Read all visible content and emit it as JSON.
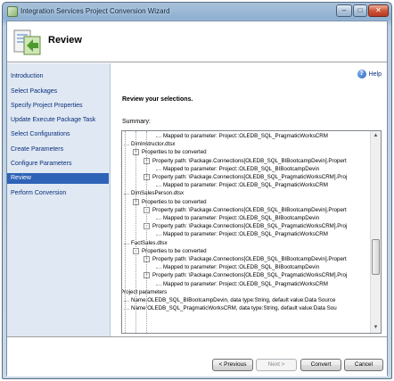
{
  "window": {
    "title": "Integration Services Project Conversion Wizard"
  },
  "header": {
    "title": "Review"
  },
  "nav": {
    "items": [
      {
        "label": "Introduction",
        "active": false
      },
      {
        "label": "Select Packages",
        "active": false
      },
      {
        "label": "Specify Project Properties",
        "active": false
      },
      {
        "label": "Update Execute Package Task",
        "active": false
      },
      {
        "label": "Select Configurations",
        "active": false
      },
      {
        "label": "Create Parameters",
        "active": false
      },
      {
        "label": "Configure Parameters",
        "active": false
      },
      {
        "label": "Review",
        "active": true
      },
      {
        "label": "Perform Conversion",
        "active": false
      }
    ]
  },
  "content": {
    "help_label": "Help",
    "heading": "Review your selections.",
    "summary_label": "Summary:",
    "tree": [
      {
        "text": "Mapped to parameter:  Project::OLEDB_SQL_PragmaticWorksCRM",
        "level": 5,
        "toggle": ""
      },
      {
        "text": "DimInstructor.dtsx",
        "level": 2,
        "toggle": ""
      },
      {
        "text": "Properties to be converted",
        "level": 3,
        "toggle": "-"
      },
      {
        "text": "Property path:  \\Package.Connections[OLEDB_SQL_BIBootcampDevin].Propert",
        "level": 4,
        "toggle": "-"
      },
      {
        "text": "Mapped to parameter:  Project::OLEDB_SQL_BIBootcampDevin",
        "level": 5,
        "toggle": ""
      },
      {
        "text": "Property path:  \\Package.Connections[OLEDB_SQL_PragmaticWorksCRM].Proj",
        "level": 4,
        "toggle": "-"
      },
      {
        "text": "Mapped to parameter:  Project::OLEDB_SQL_PragmaticWorksCRM",
        "level": 5,
        "toggle": ""
      },
      {
        "text": "DimSalesPerson.dtsx",
        "level": 2,
        "toggle": ""
      },
      {
        "text": "Properties to be converted",
        "level": 3,
        "toggle": "-"
      },
      {
        "text": "Property path:  \\Package.Connections[OLEDB_SQL_BIBootcampDevin].Propert",
        "level": 4,
        "toggle": "-"
      },
      {
        "text": "Mapped to parameter:  Project::OLEDB_SQL_BIBootcampDevin",
        "level": 5,
        "toggle": ""
      },
      {
        "text": "Property path:  \\Package.Connections[OLEDB_SQL_PragmaticWorksCRM].Proj",
        "level": 4,
        "toggle": "-"
      },
      {
        "text": "Mapped to parameter:  Project::OLEDB_SQL_PragmaticWorksCRM",
        "level": 5,
        "toggle": ""
      },
      {
        "text": "FactSales.dtsx",
        "level": 2,
        "toggle": ""
      },
      {
        "text": "Properties to be converted",
        "level": 3,
        "toggle": "-"
      },
      {
        "text": "Property path:  \\Package.Connections[OLEDB_SQL_BIBootcampDevin].Propert",
        "level": 4,
        "toggle": "-"
      },
      {
        "text": "Mapped to parameter:  Project::OLEDB_SQL_BIBootcampDevin",
        "level": 5,
        "toggle": ""
      },
      {
        "text": "Property path:  \\Package.Connections[OLEDB_SQL_PragmaticWorksCRM].Proj",
        "level": 4,
        "toggle": "-"
      },
      {
        "text": "Mapped to parameter:  Project::OLEDB_SQL_PragmaticWorksCRM",
        "level": 5,
        "toggle": ""
      },
      {
        "text": "Project parameters",
        "level": 1,
        "toggle": "-"
      },
      {
        "text": "Name:OLEDB_SQL_BIBootcampDevin, data type:String, default value:Data Source",
        "level": 2,
        "toggle": ""
      },
      {
        "text": "Name:OLEDB_SQL_PragmaticWorksCRM, data type:String, default value:Data Sou",
        "level": 2,
        "toggle": ""
      }
    ]
  },
  "footer": {
    "previous_label": "< Previous",
    "next_label": "Next >",
    "convert_label": "Convert",
    "cancel_label": "Cancel"
  }
}
